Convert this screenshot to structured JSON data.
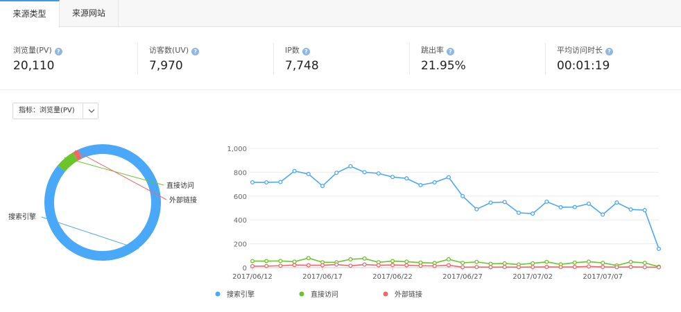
{
  "tabs": [
    {
      "label": "来源类型",
      "active": true
    },
    {
      "label": "来源网站",
      "active": false
    }
  ],
  "metrics": [
    {
      "label": "浏览量(PV)",
      "value": "20,110"
    },
    {
      "label": "访客数(UV)",
      "value": "7,970"
    },
    {
      "label": "IP数",
      "value": "7,748"
    },
    {
      "label": "跳出率",
      "value": "21.95%"
    },
    {
      "label": "平均访问时长",
      "value": "00:01:19"
    }
  ],
  "selector": {
    "label": "指标：",
    "value": "浏览量(PV)"
  },
  "icons": {
    "help": "question-circle-icon",
    "dropdown": "chevron-down-icon"
  },
  "chart_data": [
    {
      "type": "pie",
      "style": "donut",
      "slices": [
        {
          "name": "搜索引擎",
          "value": 93.0,
          "color": "#4aa8f8"
        },
        {
          "name": "直接访问",
          "value": 5.5,
          "color": "#6ac42a"
        },
        {
          "name": "外部链接",
          "value": 1.5,
          "color": "#f0676a"
        }
      ]
    },
    {
      "type": "line",
      "x": [
        "2017/06/12",
        "2017/06/13",
        "2017/06/14",
        "2017/06/15",
        "2017/06/16",
        "2017/06/17",
        "2017/06/18",
        "2017/06/19",
        "2017/06/20",
        "2017/06/21",
        "2017/06/22",
        "2017/06/23",
        "2017/06/24",
        "2017/06/25",
        "2017/06/26",
        "2017/06/27",
        "2017/06/28",
        "2017/06/29",
        "2017/06/30",
        "2017/07/01",
        "2017/07/02",
        "2017/07/03",
        "2017/07/04",
        "2017/07/05",
        "2017/07/06",
        "2017/07/07",
        "2017/07/08",
        "2017/07/09",
        "2017/07/10",
        "2017/07/11"
      ],
      "xticks": [
        "2017/06/12",
        "2017/06/17",
        "2017/06/22",
        "2017/06/27",
        "2017/07/02",
        "2017/07/07"
      ],
      "yticks": [
        "0",
        "200",
        "400",
        "600",
        "800",
        "1,000"
      ],
      "ylim": [
        0,
        1000
      ],
      "grid": true,
      "legend": "bottom",
      "series": [
        {
          "name": "搜索引擎",
          "color": "#4aa8f8",
          "values": [
            715,
            715,
            718,
            810,
            785,
            685,
            795,
            850,
            800,
            790,
            760,
            748,
            692,
            715,
            758,
            600,
            490,
            545,
            550,
            460,
            453,
            553,
            506,
            508,
            536,
            445,
            546,
            488,
            482,
            158
          ]
        },
        {
          "name": "直接访问",
          "color": "#6ac42a",
          "values": [
            55,
            55,
            56,
            50,
            80,
            45,
            45,
            70,
            76,
            45,
            55,
            50,
            42,
            38,
            70,
            40,
            48,
            32,
            35,
            26,
            36,
            48,
            27,
            42,
            50,
            40,
            18,
            48,
            40,
            8
          ]
        },
        {
          "name": "外部链接",
          "color": "#f0676a",
          "values": [
            12,
            13,
            16,
            22,
            20,
            20,
            26,
            16,
            26,
            20,
            22,
            20,
            16,
            14,
            20,
            4,
            5,
            4,
            5,
            4,
            5,
            6,
            5,
            6,
            10,
            6,
            4,
            6,
            4,
            3
          ]
        }
      ]
    }
  ]
}
